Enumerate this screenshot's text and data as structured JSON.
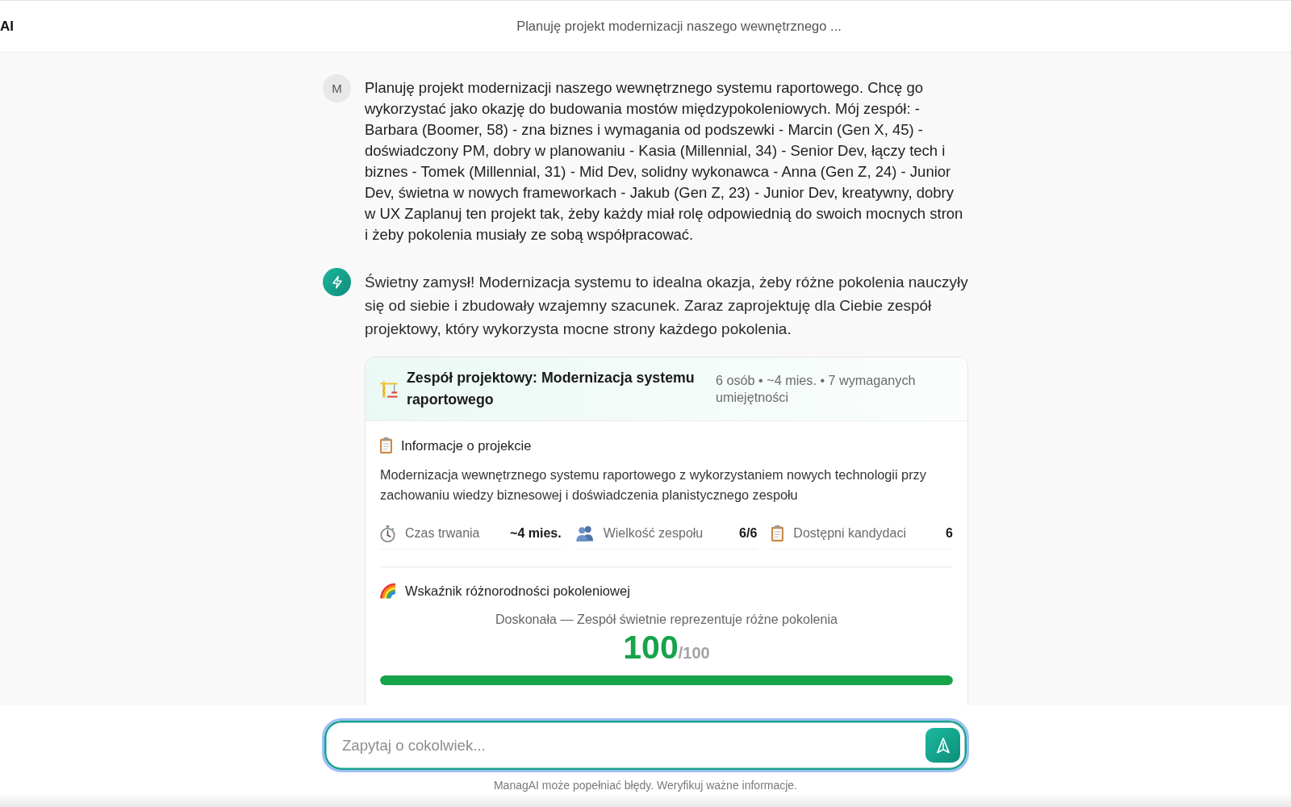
{
  "header": {
    "logo_text": "AI",
    "title": "Planuję projekt modernizacji naszego wewnętrznego ..."
  },
  "messages": [
    {
      "kind": "user",
      "avatar": "M",
      "text": "Planuję projekt modernizacji naszego wewnętrznego systemu raportowego. Chcę go wykorzystać jako okazję do budowania mostów międzypokoleniowych. Mój zespół: - Barbara (Boomer, 58) - zna biznes i wymagania od podszewki - Marcin (Gen X, 45) - doświadczony PM, dobry w planowaniu - Kasia (Millennial, 34) - Senior Dev, łączy tech i biznes - Tomek (Millennial, 31) - Mid Dev, solidny wykonawca - Anna (Gen Z, 24) - Junior Dev, świetna w nowych frameworkach - Jakub (Gen Z, 23) - Junior Dev, kreatywny, dobry w UX Zaplanuj ten projekt tak, żeby każdy miał rolę odpowiednią do swoich mocnych stron i żeby pokolenia musiały ze sobą współpracować."
    },
    {
      "kind": "assistant",
      "text": "Świetny zamysł! Modernizacja systemu to idealna okazja, żeby różne pokolenia nauczyły się od siebie i zbudowały wzajemny szacunek. Zaraz zaprojektuję dla Ciebie zespół projektowy, który wykorzysta mocne strony każdego pokolenia.",
      "card": {
        "title": "Zespół projektowy: Modernizacja systemu raportowego",
        "meta": "6 osób • ~4 mies. • 7 wymaganych umiejętności",
        "project_info": {
          "heading": "Informacje o projekcie",
          "description": "Modernizacja wewnętrznego systemu raportowego z wykorzystaniem nowych technologii przy zachowaniu wiedzy biznesowej i doświadczenia planistycznego zespołu",
          "stats": [
            {
              "kind": "duration",
              "label": "Czas trwania",
              "value": "~4 mies."
            },
            {
              "kind": "team_size",
              "label": "Wielkość zespołu",
              "value": "6/6"
            },
            {
              "kind": "candidates",
              "label": "Dostępni kandydaci",
              "value": "6"
            }
          ]
        },
        "diversity": {
          "heading": "Wskaźnik różnorodności pokoleniowej",
          "rating": "Doskonała — Zespół świetnie reprezentuje różne pokolenia",
          "score": "100",
          "max": "/100",
          "level": 1
        }
      }
    }
  ],
  "composer": {
    "placeholder": "Zapytaj o cokolwiek..."
  },
  "disclaimer": "ManagAI może popełniać błędy. Weryfikuj ważne informacje."
}
